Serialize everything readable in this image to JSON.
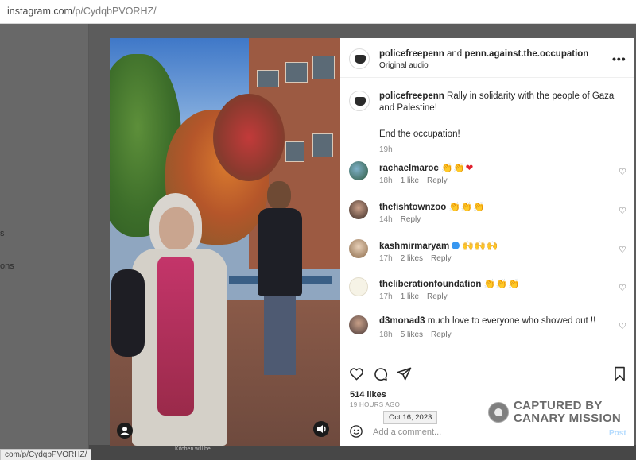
{
  "browser": {
    "url_host": "instagram.com",
    "url_path": "/p/CydqbPVORHZ/",
    "status_url": "com/p/CydqbPVORHZ/"
  },
  "background_page": {
    "sidebar_fragment_1": "s",
    "sidebar_fragment_2": "ons",
    "bottom_caption": "Kitchen will be"
  },
  "post": {
    "header": {
      "author": "policefreepenn",
      "joiner": "and",
      "collaborator": "penn.against.the.occupation",
      "audio": "Original audio",
      "more_icon": "more-horizontal-icon"
    },
    "caption": {
      "author": "policefreepenn",
      "text_1": "Rally in solidarity with the people of Gaza and Palestine!",
      "text_2": "End the occupation!",
      "time": "19h"
    },
    "comments": [
      {
        "user": "rachaelmaroc",
        "text": "👏👏",
        "heart": "❤",
        "time": "18h",
        "likes": "1 like",
        "reply": "Reply",
        "verified": false
      },
      {
        "user": "thefishtownzoo",
        "text": "👏👏👏",
        "heart": "",
        "time": "14h",
        "likes": "",
        "reply": "Reply",
        "verified": false
      },
      {
        "user": "kashmirmaryam",
        "text": "🙌🙌🙌",
        "heart": "",
        "time": "17h",
        "likes": "2 likes",
        "reply": "Reply",
        "verified": true
      },
      {
        "user": "theliberationfoundation",
        "text": "👏👏👏",
        "heart": "",
        "time": "17h",
        "likes": "1 like",
        "reply": "Reply",
        "verified": false
      },
      {
        "user": "d3monad3",
        "text": "much love to everyone who showed out !!",
        "heart": "",
        "time": "18h",
        "likes": "5 likes",
        "reply": "Reply",
        "verified": false
      }
    ],
    "likes": "514 likes",
    "ago": "19 HOURS AGO",
    "date_tooltip": "Oct 16, 2023",
    "add_comment_placeholder": "Add a comment...",
    "post_label": "Post"
  },
  "watermark": {
    "line1": "CAPTURED BY",
    "line2": "CANARY MISSION"
  },
  "colors": {
    "link_blue": "#3897f0",
    "text": "#262626",
    "secondary": "#8e8e8e"
  }
}
